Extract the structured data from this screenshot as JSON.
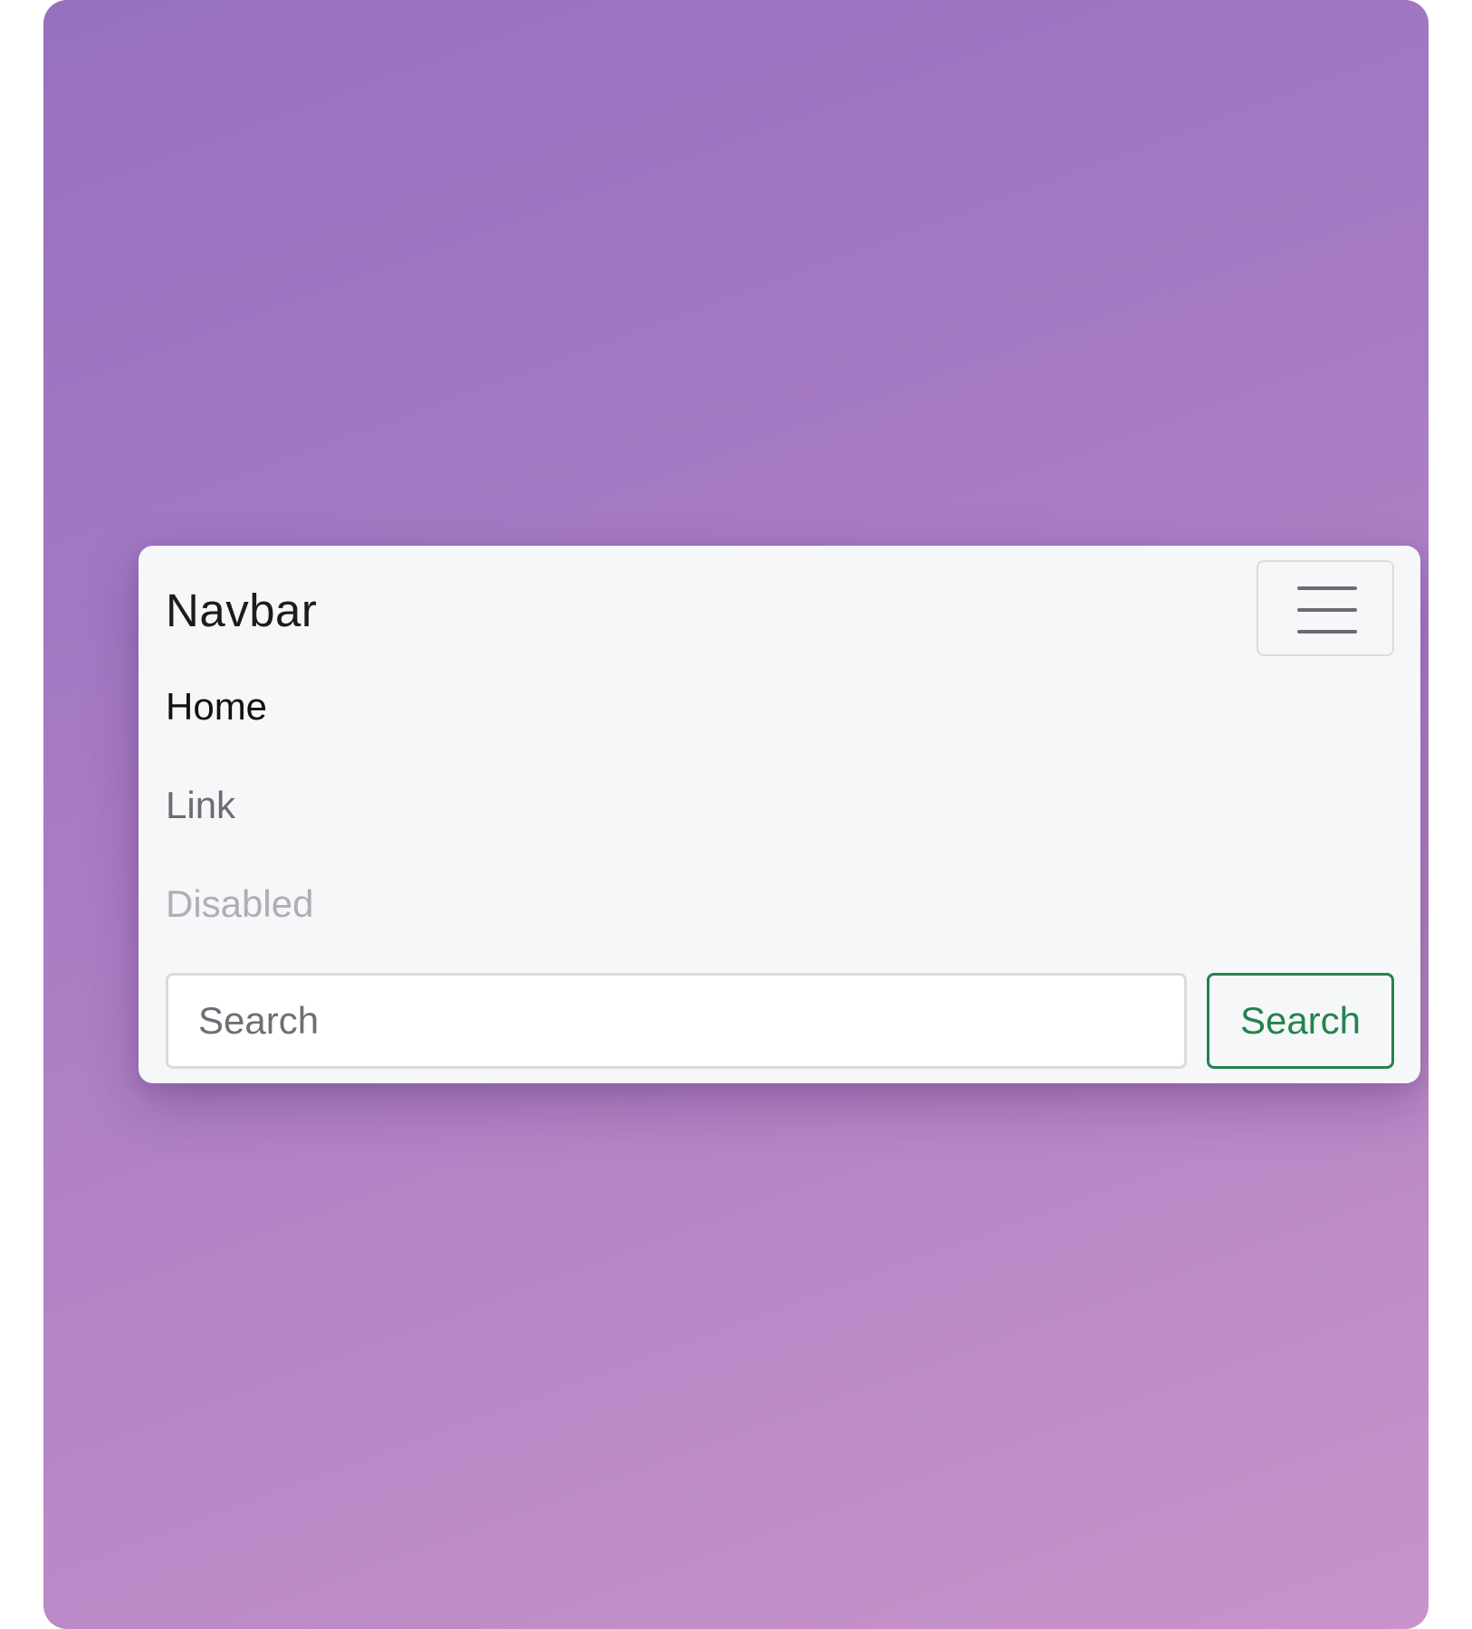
{
  "navbar": {
    "brand": "Navbar",
    "toggler_icon": "hamburger-menu-icon",
    "links": {
      "home": "Home",
      "link": "Link",
      "disabled": "Disabled"
    },
    "search": {
      "placeholder": "Search",
      "value": "",
      "button_label": "Search"
    }
  },
  "colors": {
    "background_gradient_start": "#9770c0",
    "background_gradient_end": "#c993cb",
    "navbar_bg": "#f6f7f9",
    "success_outline": "#23834f"
  }
}
